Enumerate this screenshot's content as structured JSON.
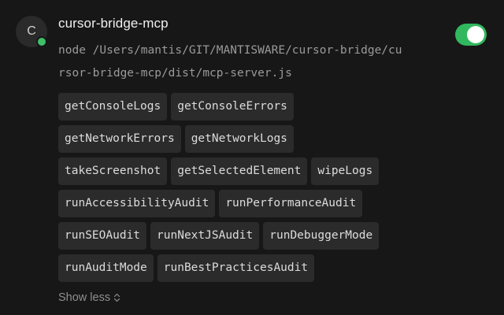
{
  "server": {
    "avatar_letter": "C",
    "name": "cursor-bridge-mcp",
    "command": "node /Users/mantis/GIT/MANTISWARE/cursor-bridge/cursor-bridge-mcp/dist/mcp-server.js",
    "enabled": true
  },
  "tool_rows": [
    [
      "getConsoleLogs",
      "getConsoleErrors"
    ],
    [
      "getNetworkErrors",
      "getNetworkLogs"
    ],
    [
      "takeScreenshot",
      "getSelectedElement",
      "wipeLogs"
    ],
    [
      "runAccessibilityAudit",
      "runPerformanceAudit"
    ],
    [
      "runSEOAudit",
      "runNextJSAudit",
      "runDebuggerMode"
    ],
    [
      "runAuditMode",
      "runBestPracticesAudit"
    ]
  ],
  "show_less_label": "Show less",
  "colors": {
    "toggle_on": "#31b85e",
    "status_online": "#3fbf6a",
    "chip_bg": "#2b2b2b"
  }
}
